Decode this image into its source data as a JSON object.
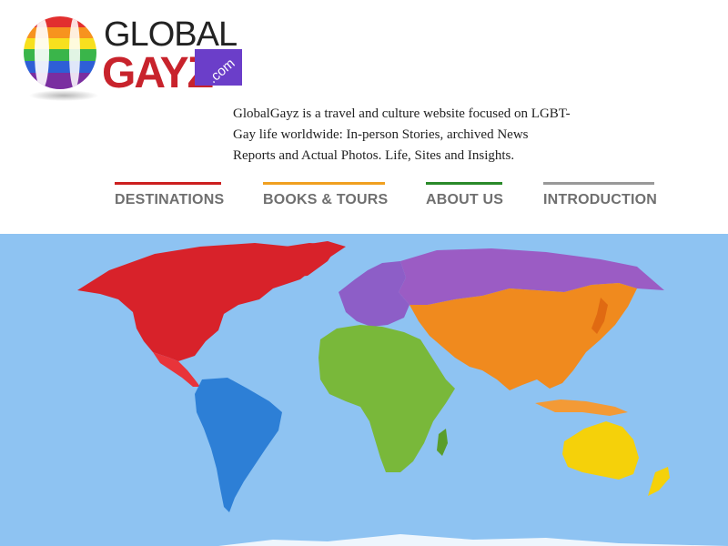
{
  "logo": {
    "word_global": "GLOBAL",
    "word_gayz": "GAYZ",
    "word_com": ".com"
  },
  "tagline": "GlobalGayz is a travel and culture website focused on LGBT-Gay life worldwide: In-person Stories, archived News Reports and Actual Photos. Life, Sites and Insights.",
  "nav": {
    "items": [
      {
        "label": "DESTINATIONS",
        "color": "#cc1f1f"
      },
      {
        "label": "BOOKS & TOURS",
        "color": "#f0a020"
      },
      {
        "label": "ABOUT US",
        "color": "#2a8a2a"
      },
      {
        "label": "INTRODUCTION",
        "color": "#999999"
      }
    ]
  },
  "map": {
    "ocean_color": "#8ec3f2",
    "regions": [
      {
        "name": "north-america",
        "color": "#d8222a"
      },
      {
        "name": "south-america",
        "color": "#2d7fd6"
      },
      {
        "name": "europe",
        "color": "#8d5ec7"
      },
      {
        "name": "russia",
        "color": "#9b5cc4"
      },
      {
        "name": "africa",
        "color": "#79b83a"
      },
      {
        "name": "asia",
        "color": "#f08a1e"
      },
      {
        "name": "australia",
        "color": "#f5d10a"
      }
    ]
  }
}
